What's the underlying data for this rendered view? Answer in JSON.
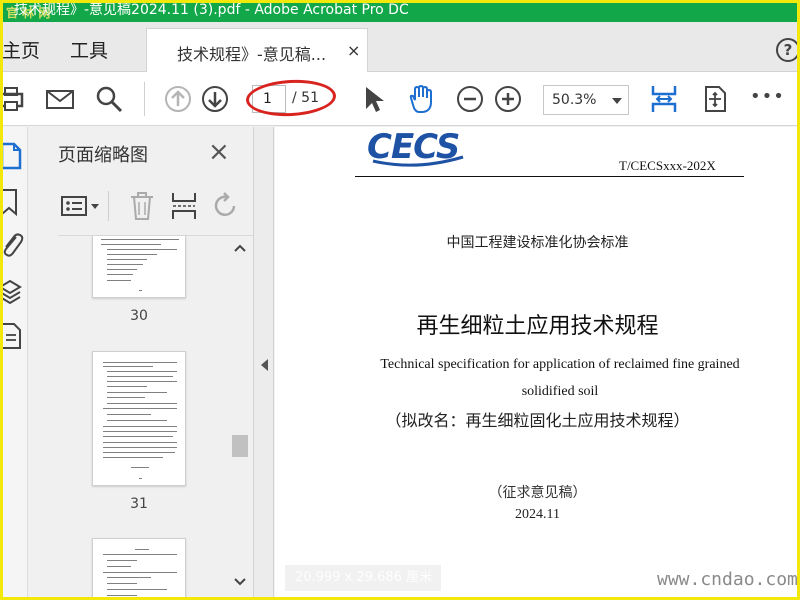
{
  "titlebar": {
    "title": "技术规程》-意见稿2024.11 (3).pdf - Adobe Acrobat Pro DC",
    "logo_text": "官 林 网"
  },
  "menubar": {
    "home": "主页",
    "tools": "工具",
    "tab_label": "技术规程》-意见稿...",
    "tab_close": "×",
    "help": "?"
  },
  "toolbar": {
    "icons": [
      "print-icon",
      "email-icon",
      "search-icon",
      "prev-page-icon",
      "next-page-icon",
      "select-arrow-icon",
      "hand-tool-icon",
      "zoom-out-icon",
      "zoom-in-icon",
      "fit-width-icon",
      "full-screen-icon",
      "more-icon"
    ],
    "current_page": "1",
    "total_pages": "/ 51",
    "zoom": "50.3%",
    "more": "•••"
  },
  "panel": {
    "title": "页面缩略图",
    "close": "×",
    "thumbnails": [
      {
        "page": "30"
      },
      {
        "page": "31"
      },
      {
        "page": ""
      }
    ]
  },
  "document": {
    "logo": "CECS",
    "standard_code": "T/CECSxxx-202X",
    "organization": "中国工程建设标准化协会标准",
    "title_cn": "再生细粒土应用技术规程",
    "title_en_line1": "Technical specification for application of reclaimed fine grained",
    "title_en_line2": "solidified soil",
    "alt_name": "（拟改名：再生细粒固化土应用技术规程）",
    "draft_status": "（征求意见稿）",
    "date": "2024.11",
    "page_dimensions": "20.999 x 29.686 厘米"
  },
  "watermark": "www.cndao.com",
  "colors": {
    "titlebar_bg": "#12a84a",
    "accent_blue": "#1e6fd0",
    "annotation_red": "#d8231f",
    "frame_yellow": "#f2e80a",
    "cecs_blue": "#1e52a4"
  }
}
